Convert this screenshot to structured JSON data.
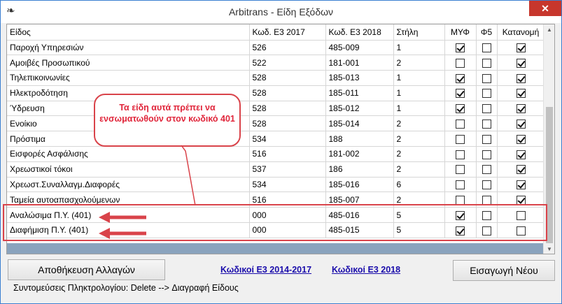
{
  "window": {
    "title": "Arbitrans - Είδη Εξόδων",
    "app_icon": "arbitrans-logo-icon",
    "close_label": "✕"
  },
  "grid": {
    "columns": [
      "Είδος",
      "Κωδ. Ε3 2017",
      "Κωδ. Ε3 2018",
      "Στήλη",
      "ΜΥΦ",
      "Φ5",
      "Κατανομή"
    ],
    "rows": [
      {
        "name": "Παροχή Υπηρεσιών",
        "e3_2017": "526",
        "e3_2018": "485-009",
        "col": "1",
        "myf": true,
        "f5": false,
        "katanomi": true
      },
      {
        "name": "Αμοιβές Προσωπικού",
        "e3_2017": "522",
        "e3_2018": "181-001",
        "col": "2",
        "myf": false,
        "f5": false,
        "katanomi": true
      },
      {
        "name": "Τηλεπικοινωνίες",
        "e3_2017": "528",
        "e3_2018": "185-013",
        "col": "1",
        "myf": true,
        "f5": false,
        "katanomi": true
      },
      {
        "name": "Ηλεκτροδότηση",
        "e3_2017": "528",
        "e3_2018": "185-011",
        "col": "1",
        "myf": true,
        "f5": false,
        "katanomi": true
      },
      {
        "name": "Ύδρευση",
        "e3_2017": "528",
        "e3_2018": "185-012",
        "col": "1",
        "myf": true,
        "f5": false,
        "katanomi": true
      },
      {
        "name": " Ενοίκιο",
        "e3_2017": "528",
        "e3_2018": "185-014",
        "col": "2",
        "myf": false,
        "f5": false,
        "katanomi": true
      },
      {
        "name": "Πρόστιμα",
        "e3_2017": "534",
        "e3_2018": "188",
        "col": "2",
        "myf": false,
        "f5": false,
        "katanomi": true
      },
      {
        "name": "Εισφορές Ασφάλισης",
        "e3_2017": "516",
        "e3_2018": "181-002",
        "col": "2",
        "myf": false,
        "f5": false,
        "katanomi": true
      },
      {
        "name": "Χρεωστικοί τόκοι",
        "e3_2017": "537",
        "e3_2018": "186",
        "col": "2",
        "myf": false,
        "f5": false,
        "katanomi": true
      },
      {
        "name": "Χρεωστ.Συναλλαγμ.Διαφορές",
        "e3_2017": "534",
        "e3_2018": "185-016",
        "col": "6",
        "myf": false,
        "f5": false,
        "katanomi": true
      },
      {
        "name": "Ταμεία αυτοαπασχολούμενων",
        "e3_2017": "516",
        "e3_2018": "185-007",
        "col": "2",
        "myf": false,
        "f5": false,
        "katanomi": true
      },
      {
        "name": "Αναλώσιμα Π.Υ. (401)",
        "e3_2017": "000",
        "e3_2018": "485-016",
        "col": "5",
        "myf": true,
        "f5": false,
        "katanomi": false
      },
      {
        "name": "Διαφήμιση Π.Υ. (401)",
        "e3_2017": "000",
        "e3_2018": "485-015",
        "col": "5",
        "myf": true,
        "f5": false,
        "katanomi": false
      }
    ]
  },
  "annotation": {
    "callout_text": "Τα είδη αυτά πρέπει να ενσωματωθούν στον κωδικό 401",
    "accent": "#d9434a",
    "text_color": "#e0253a"
  },
  "footer": {
    "save_label": "Αποθήκευση Αλλαγών",
    "link_2017": "Κωδικοί Ε3 2014-2017",
    "link_2018": "Κωδικοί Ε3 2018",
    "new_label": "Εισαγωγή Νέου",
    "shortcuts_text": "Συντομεύσεις Πληκτρολογίου: Delete --> Διαγραφή Είδους"
  }
}
